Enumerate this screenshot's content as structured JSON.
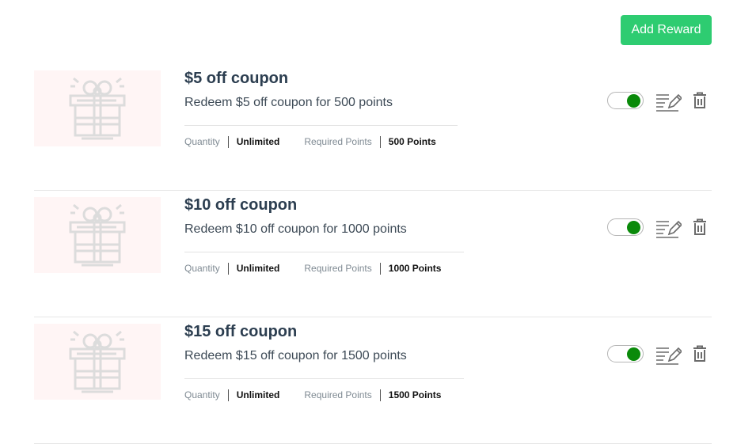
{
  "header": {
    "add_button_label": "Add Reward",
    "accent_color": "#2ecc71"
  },
  "rewards": [
    {
      "title": "$5 off coupon",
      "description": "Redeem $5 off coupon for 500 points",
      "quantity_label": "Quantity",
      "quantity_value": "Unlimited",
      "points_label": "Required Points",
      "points_value": "500 Points",
      "enabled": true,
      "image_icon": "gift-icon"
    },
    {
      "title": "$10 off coupon",
      "description": "Redeem $10 off coupon for 1000 points",
      "quantity_label": "Quantity",
      "quantity_value": "Unlimited",
      "points_label": "Required Points",
      "points_value": "1000 Points",
      "enabled": true,
      "image_icon": "gift-icon"
    },
    {
      "title": "$15 off coupon",
      "description": "Redeem $15 off coupon for 1500 points",
      "quantity_label": "Quantity",
      "quantity_value": "Unlimited",
      "points_label": "Required Points",
      "points_value": "1500 Points",
      "enabled": true,
      "image_icon": "gift-icon"
    }
  ],
  "icons": {
    "edit": "edit-icon",
    "delete": "trash-icon"
  },
  "colors": {
    "toggle_on": "#0a8a0a",
    "thumb_bg": "#fff5f5"
  }
}
